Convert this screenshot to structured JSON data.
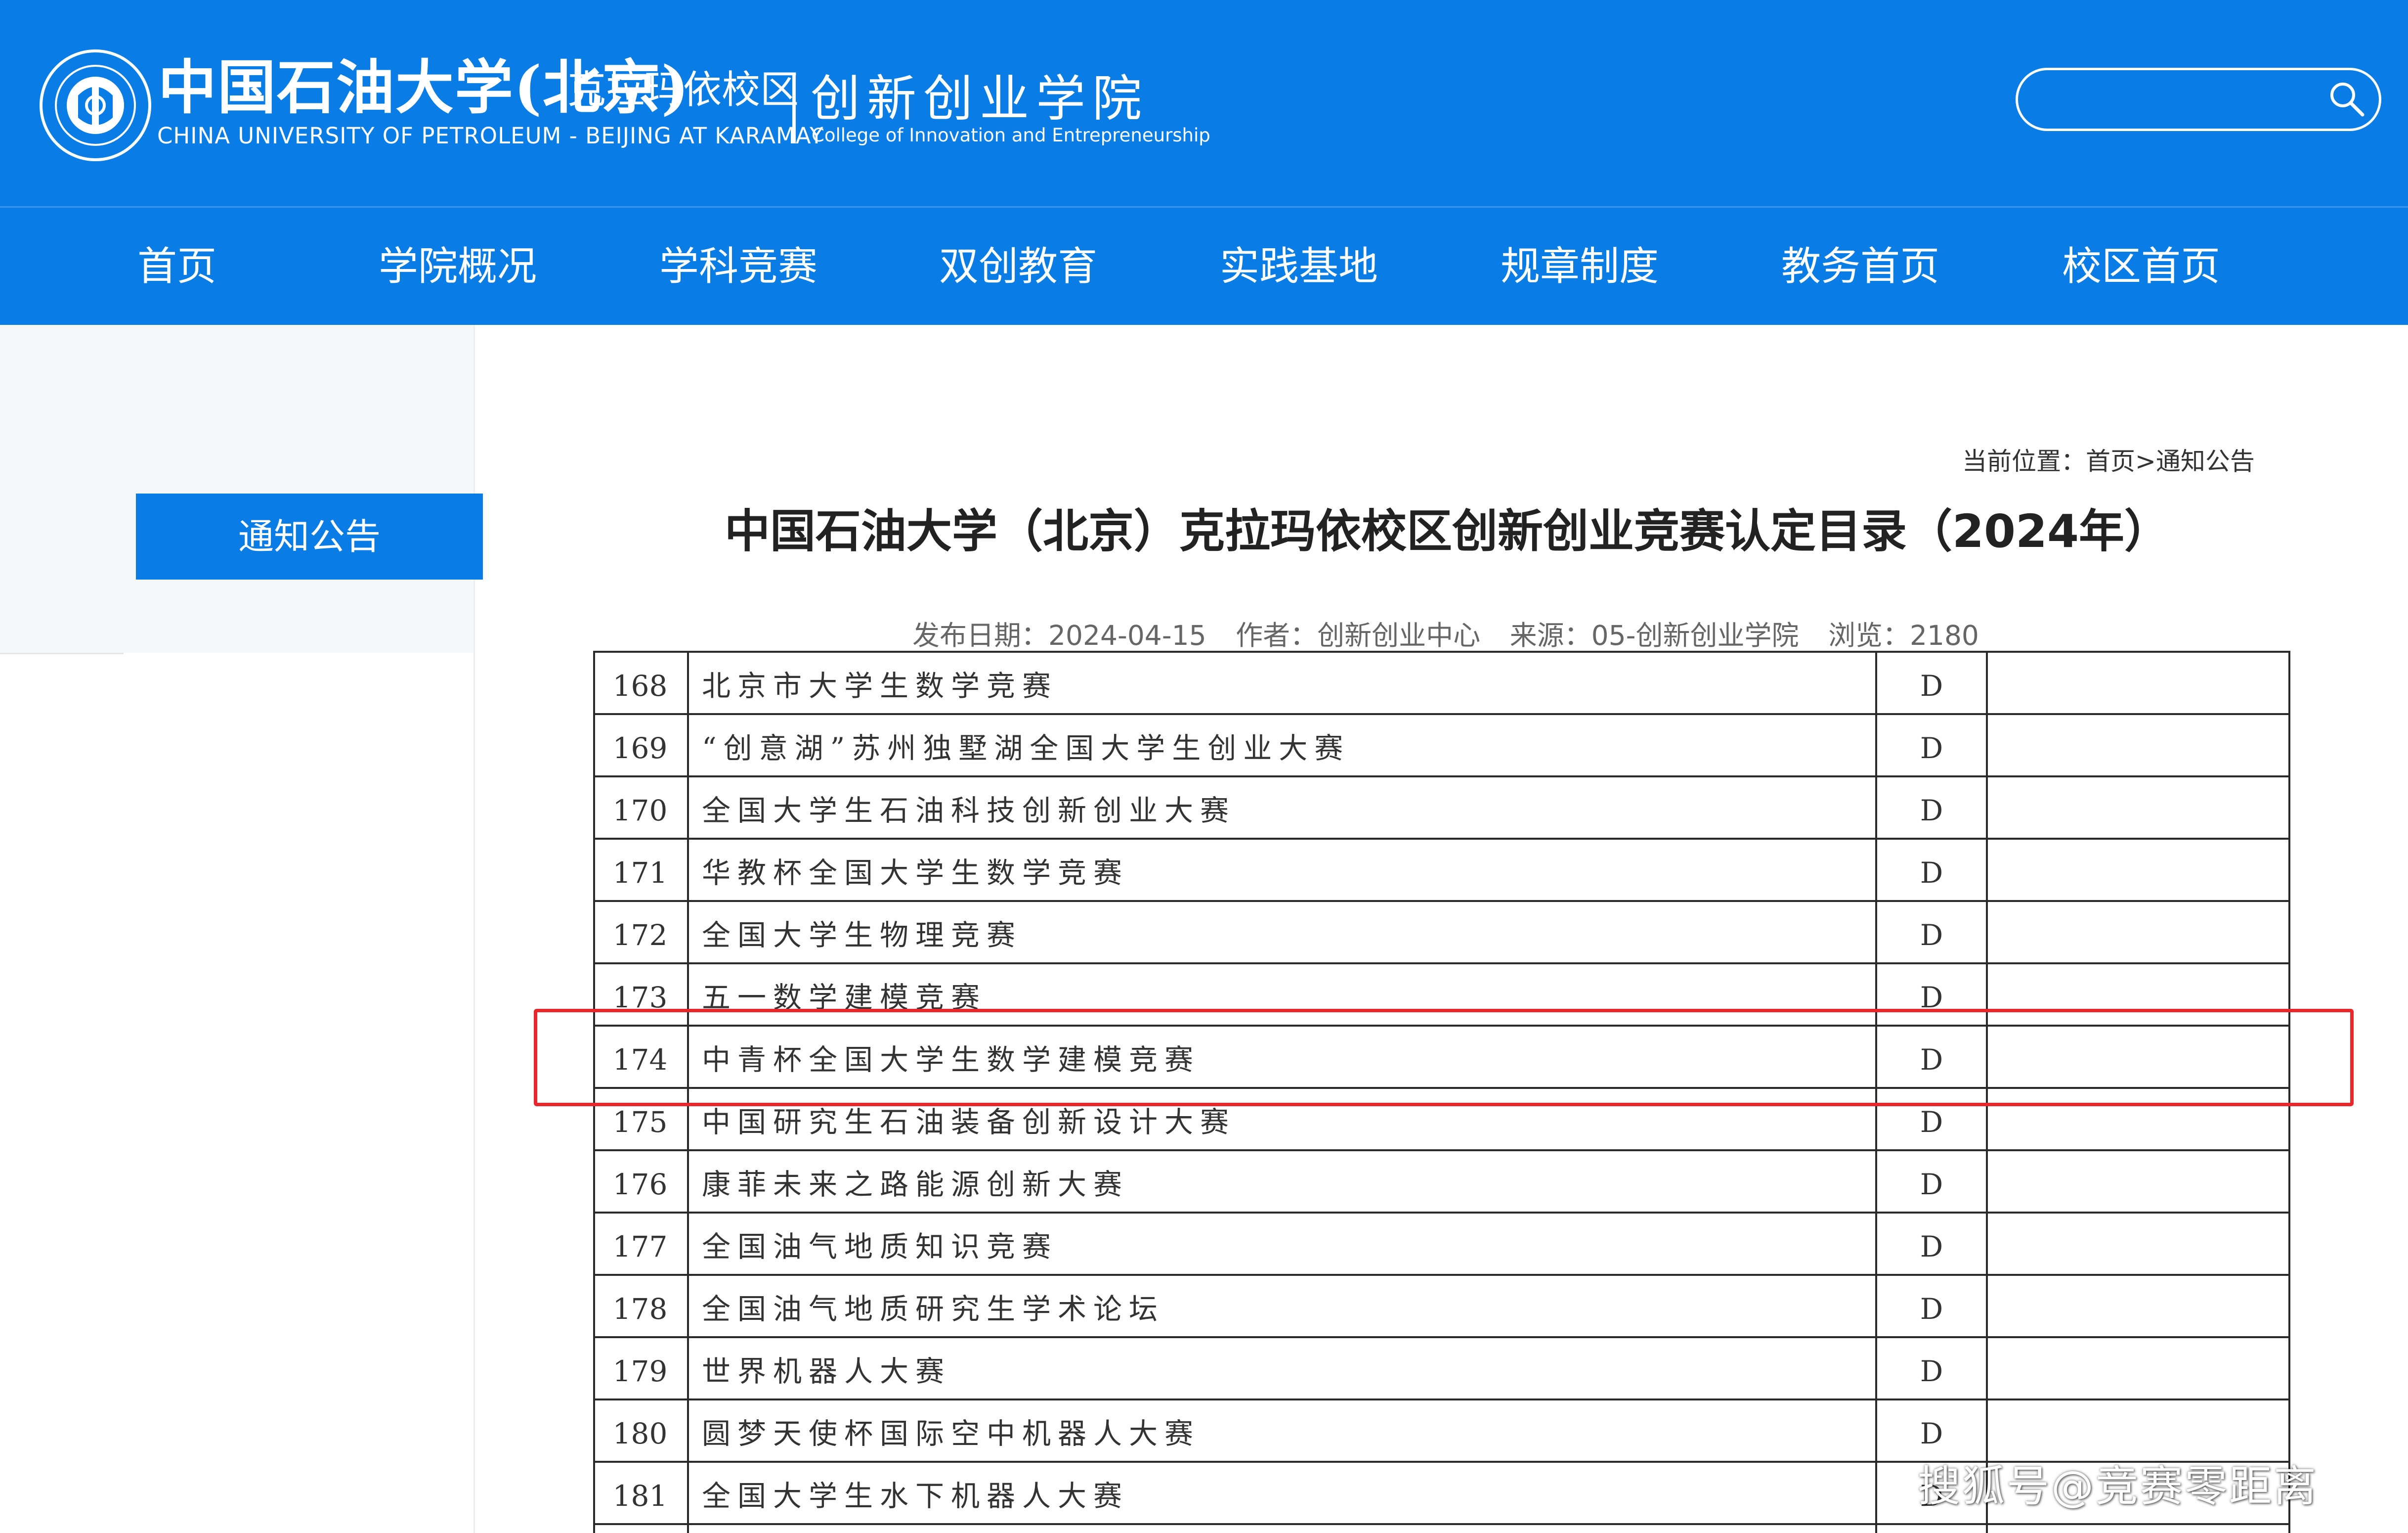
{
  "header": {
    "logo_cn": "中国石油大学(北京)",
    "logo_cn_campus": "克拉玛依校区",
    "logo_en": "CHINA UNIVERSITY OF PETROLEUM - BEIJING  AT KARAMAY",
    "college_cn": "创新创业学院",
    "college_en": "College of Innovation and Entrepreneurship",
    "logo_icon": "university-seal",
    "search_icon": "magnifier"
  },
  "search": {
    "value": ""
  },
  "nav": {
    "items": [
      {
        "label": "首页"
      },
      {
        "label": "学院概况"
      },
      {
        "label": "学科竞赛"
      },
      {
        "label": "双创教育"
      },
      {
        "label": "实践基地"
      },
      {
        "label": "规章制度"
      },
      {
        "label": "教务首页"
      },
      {
        "label": "校区首页"
      }
    ]
  },
  "sidebar": {
    "active_label": "通知公告"
  },
  "breadcrumb": {
    "text": "当前位置：首页>通知公告"
  },
  "article": {
    "title": "中国石油大学（北京）克拉玛依校区创新创业竞赛认定目录（2024年）",
    "date": "发布日期：2024-04-15",
    "author": "作者：创新创业中心",
    "source": "来源：05-创新创业学院",
    "views": "浏览：2180"
  },
  "table": {
    "rows": [
      {
        "num": "168",
        "name": "北京市大学生数学竞赛",
        "grade": "D"
      },
      {
        "num": "169",
        "name": "“创意湖”苏州独墅湖全国大学生创业大赛",
        "grade": "D"
      },
      {
        "num": "170",
        "name": "全国大学生石油科技创新创业大赛",
        "grade": "D"
      },
      {
        "num": "171",
        "name": "华教杯全国大学生数学竞赛",
        "grade": "D"
      },
      {
        "num": "172",
        "name": "全国大学生物理竞赛",
        "grade": "D"
      },
      {
        "num": "173",
        "name": "五一数学建模竞赛",
        "grade": "D"
      },
      {
        "num": "174",
        "name": "中青杯全国大学生数学建模竞赛",
        "grade": "D"
      },
      {
        "num": "175",
        "name": "中国研究生石油装备创新设计大赛",
        "grade": "D"
      },
      {
        "num": "176",
        "name": "康菲未来之路能源创新大赛",
        "grade": "D"
      },
      {
        "num": "177",
        "name": "全国油气地质知识竞赛",
        "grade": "D"
      },
      {
        "num": "178",
        "name": "全国油气地质研究生学术论坛",
        "grade": "D"
      },
      {
        "num": "179",
        "name": "世界机器人大赛",
        "grade": "D"
      },
      {
        "num": "180",
        "name": "圆梦天使杯国际空中机器人大赛",
        "grade": "D"
      },
      {
        "num": "181",
        "name": "全国大学生水下机器人大赛",
        "grade": "D"
      }
    ],
    "highlighted_row": "174"
  },
  "colors": {
    "brand_blue": "#0a7ce6",
    "highlight_red": "#e8262b"
  },
  "watermark": "搜狐号@竞赛零距离"
}
